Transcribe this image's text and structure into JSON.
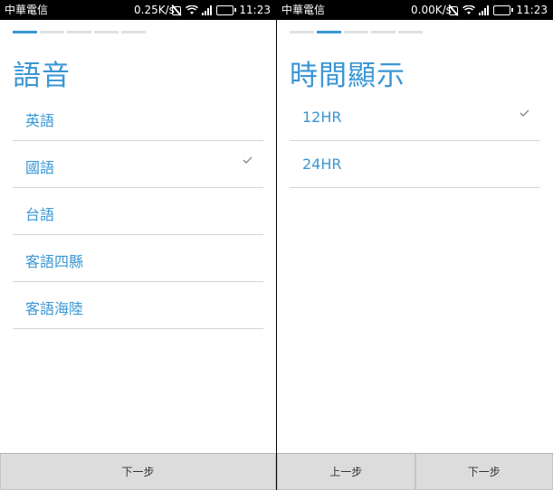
{
  "left": {
    "status": {
      "carrier": "中華電信",
      "speed": "0.25K/s",
      "time": "11:23",
      "battery_color": "#4cd137"
    },
    "steps": {
      "count": 5,
      "active": 0
    },
    "title": "語音",
    "options": [
      {
        "label": "英語",
        "selected": false
      },
      {
        "label": "國語",
        "selected": true
      },
      {
        "label": "台語",
        "selected": false
      },
      {
        "label": "客語四縣",
        "selected": false
      },
      {
        "label": "客語海陸",
        "selected": false
      }
    ],
    "buttons": {
      "next": "下一步"
    }
  },
  "right": {
    "status": {
      "carrier": "中華電信",
      "speed": "0.00K/s",
      "time": "11:23",
      "battery_color": "#4cd137"
    },
    "steps": {
      "count": 5,
      "active": 1
    },
    "title": "時間顯示",
    "options": [
      {
        "label": "12HR",
        "selected": true
      },
      {
        "label": "24HR",
        "selected": false
      }
    ],
    "buttons": {
      "prev": "上一步",
      "next": "下一步"
    }
  },
  "colors": {
    "accent": "#3a96d4",
    "divider": "#d4d4d4",
    "check": "#8a8a8a"
  }
}
